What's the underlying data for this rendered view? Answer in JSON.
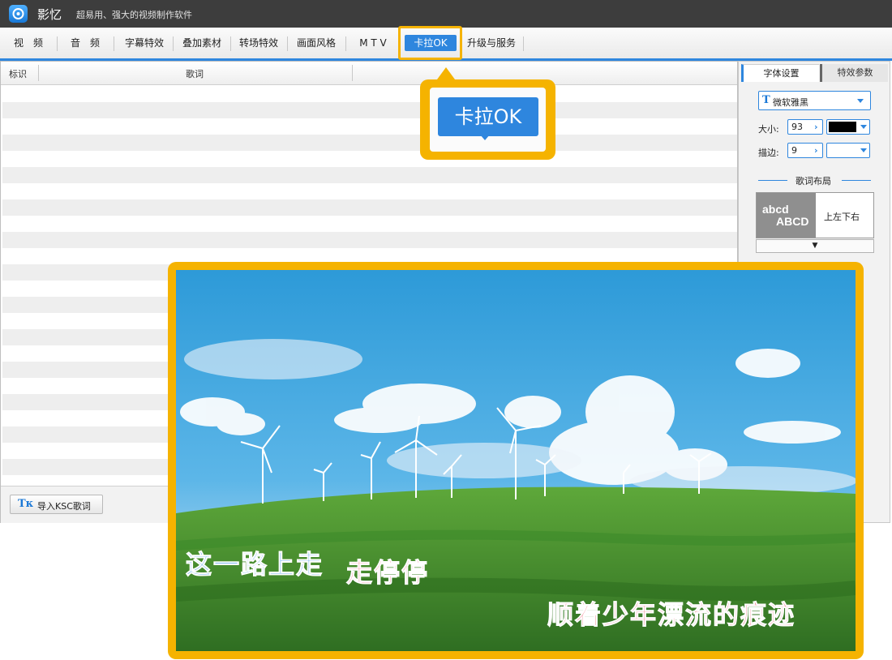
{
  "app": {
    "name": "影忆",
    "slogan": "超易用、强大的视频制作软件"
  },
  "menu": [
    {
      "label": "视　频"
    },
    {
      "label": "音　频"
    },
    {
      "label": "字幕特效"
    },
    {
      "label": "叠加素材"
    },
    {
      "label": "转场特效"
    },
    {
      "label": "画面风格"
    },
    {
      "label": "M T V"
    },
    {
      "label": "卡拉OK"
    },
    {
      "label": "升级与服务"
    }
  ],
  "lyrics_table": {
    "columns": [
      "标识",
      "歌词"
    ],
    "import_button": "导入KSC歌词"
  },
  "right_panel": {
    "tabs": [
      "字体设置",
      "特效参数"
    ],
    "font_name": "微软雅黑",
    "size_label": "大小:",
    "size_value": "93",
    "stroke_label": "描边:",
    "stroke_value": "9",
    "text_color": "#000000",
    "layout_section": "歌词布局",
    "layout_sample_line1": "abcd",
    "layout_sample_line2": "ABCD",
    "layout_option": "上左下右",
    "expand_glyph": "▼"
  },
  "callout": {
    "label": "卡拉OK"
  },
  "preview": {
    "lyric_left_sung": "这一路上走",
    "lyric_left_unsung": "走停停",
    "lyric_right": "顺着少年漂流的痕迹"
  },
  "colors": {
    "accent_blue": "#2e86de",
    "highlight_yellow": "#f5b300",
    "titlebar": "#3d3d3d",
    "lyric_sung": "#2f8fe6",
    "lyric_unsung": "#f06b7a"
  }
}
